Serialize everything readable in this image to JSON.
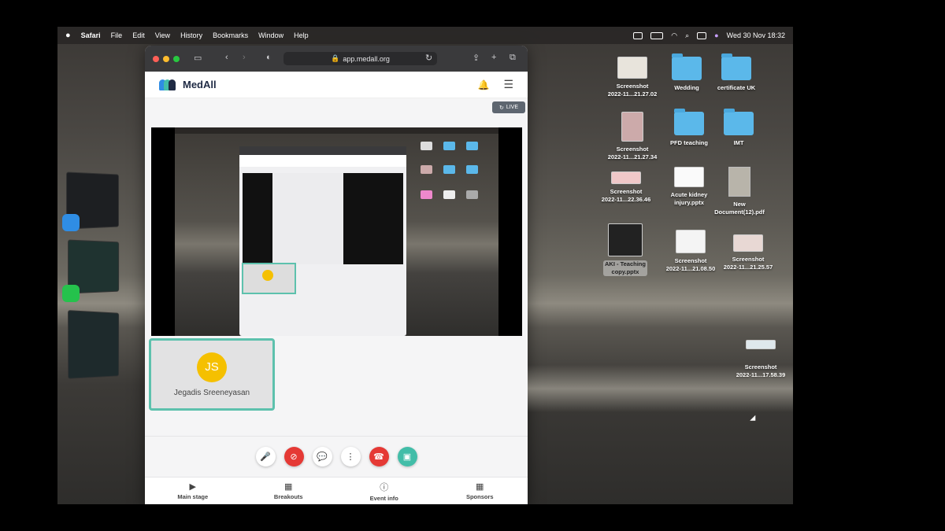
{
  "menubar": {
    "app": "Safari",
    "items": [
      "File",
      "Edit",
      "View",
      "History",
      "Bookmarks",
      "Window",
      "Help"
    ],
    "clock": "Wed 30 Nov  18:32"
  },
  "browser": {
    "url": "app.medall.org"
  },
  "app": {
    "brand": "MedAll",
    "live_label": "LIVE",
    "participant": {
      "initials": "JS",
      "name": "Jegadis Sreeneyasan"
    },
    "controls": [
      {
        "name": "mic-button",
        "icon": "microphone-icon",
        "glyph": "🎤",
        "style": "white"
      },
      {
        "name": "camera-off-button",
        "icon": "camera-off-icon",
        "glyph": "⊘",
        "style": "red"
      },
      {
        "name": "chat-button",
        "icon": "chat-icon",
        "glyph": "💬",
        "style": "white"
      },
      {
        "name": "more-button",
        "icon": "more-vertical-icon",
        "glyph": "⋮",
        "style": "white"
      },
      {
        "name": "end-call-button",
        "icon": "phone-hangup-icon",
        "glyph": "☎",
        "style": "red"
      },
      {
        "name": "share-button",
        "icon": "share-screen-icon",
        "glyph": "▣",
        "style": "teal"
      }
    ],
    "tabs": [
      {
        "label": "Main stage",
        "icon": "▶"
      },
      {
        "label": "Breakouts",
        "icon": "▦"
      },
      {
        "label": "Event info",
        "icon": "ⓘ"
      },
      {
        "label": "Sponsors",
        "icon": "▦"
      }
    ]
  },
  "desktop": {
    "icons": [
      {
        "label": "Screenshot\n2022-11...21.27.02",
        "kind": "thumb"
      },
      {
        "label": "Wedding",
        "kind": "folder"
      },
      {
        "label": "certificate UK",
        "kind": "folder"
      },
      {
        "label": "Screenshot\n2022-11...21.27.34",
        "kind": "thumb"
      },
      {
        "label": "PFD teaching",
        "kind": "folder"
      },
      {
        "label": "IMT",
        "kind": "folder"
      },
      {
        "label": "Screenshot\n2022-11...22.36.46",
        "kind": "thumb"
      },
      {
        "label": "Acute kidney\ninjury.pptx",
        "kind": "doc"
      },
      {
        "label": "New\nDocument(12).pdf",
        "kind": "doc"
      },
      {
        "label": "AKI - Teaching\ncopy.pptx",
        "kind": "dark",
        "selected": true
      },
      {
        "label": "Screenshot\n2022-11...21.08.50",
        "kind": "thumb"
      },
      {
        "label": "Screenshot\n2022-11...21.25.57",
        "kind": "thumb"
      },
      {
        "label": "Screenshot\n2022-11...17.58.39",
        "kind": "thumb"
      }
    ]
  }
}
